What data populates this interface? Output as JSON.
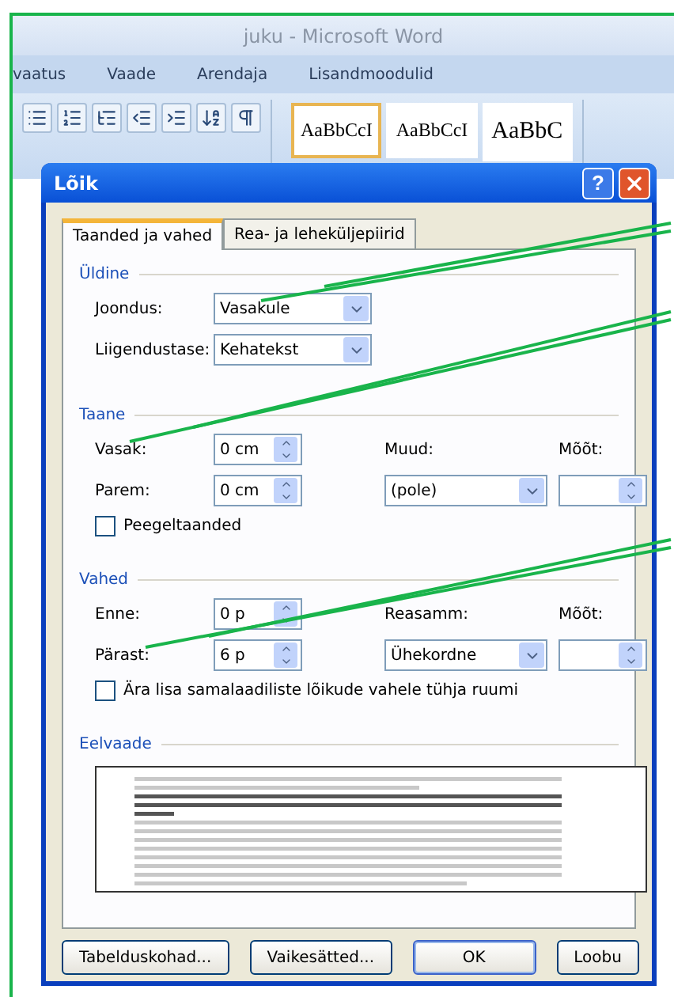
{
  "app_window": {
    "title": "juku - Microsoft Word",
    "ribbon_tabs": [
      "vaatus",
      "Vaade",
      "Arendaja",
      "Lisandmoodulid"
    ],
    "styles": [
      {
        "label": "AaBbCcI",
        "selected": true
      },
      {
        "label": "AaBbCcI",
        "selected": false
      },
      {
        "label": "AaBbC",
        "selected": false
      }
    ]
  },
  "dialog": {
    "title": "Lõik",
    "help_button": "?",
    "tabs": [
      {
        "label": "Taanded ja vahed",
        "selected": true
      },
      {
        "label": "Rea- ja leheküljepiirid",
        "selected": false
      }
    ],
    "general": {
      "heading": "Üldine",
      "rows": [
        {
          "label": "Joondus:",
          "value": "Vasakule"
        },
        {
          "label": "Liigendustase:",
          "value": "Kehatekst"
        }
      ]
    },
    "indentation": {
      "heading": "Taane",
      "left": {
        "label": "Vasak:",
        "value": "0 cm"
      },
      "right": {
        "label": "Parem:",
        "value": "0 cm"
      },
      "special": {
        "label": "Muud:",
        "value": "(pole)"
      },
      "by": {
        "label": "Mõõt:"
      },
      "mirror": {
        "label": "Peegeltaanded",
        "checked": false
      }
    },
    "spacing": {
      "heading": "Vahed",
      "before": {
        "label": "Enne:",
        "value": "0 p"
      },
      "after": {
        "label": "Pärast:",
        "value": "6 p"
      },
      "line_spacing": {
        "label": "Reasamm:",
        "value": "Ühekordne"
      },
      "at": {
        "label": "Mõõt:"
      },
      "no_space": {
        "label": "Ära lisa samalaadiliste lõikude vahele tühja ruumi",
        "checked": false
      }
    },
    "preview": {
      "heading": "Eelvaade"
    },
    "buttons": [
      {
        "label": "Tabelduskohad...",
        "default": false
      },
      {
        "label": "Vaikesätted...",
        "default": false
      },
      {
        "label": "OK",
        "default": true
      },
      {
        "label": "Loobu",
        "default": false
      }
    ]
  }
}
